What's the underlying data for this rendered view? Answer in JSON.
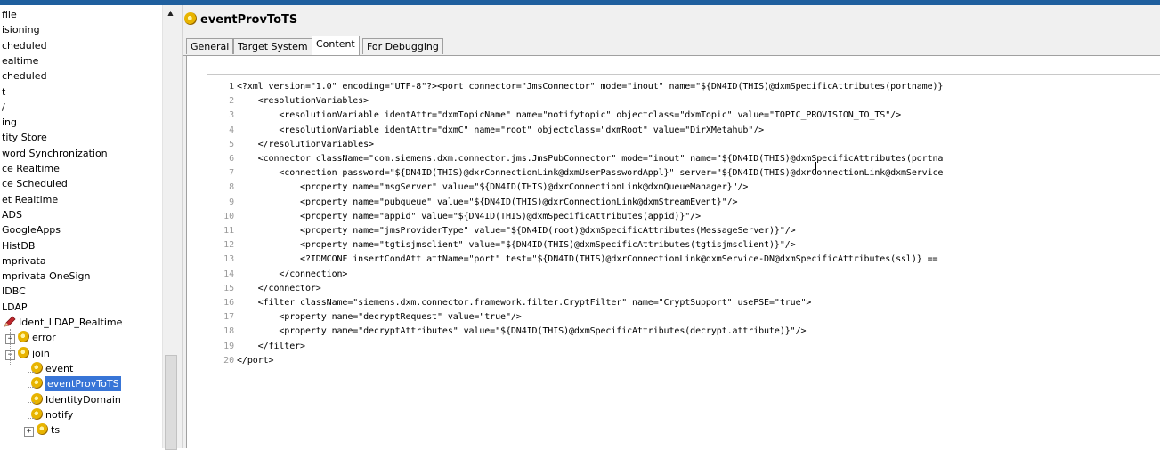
{
  "tree": {
    "items": [
      {
        "label": "file"
      },
      {
        "label": "isioning"
      },
      {
        "label": "cheduled"
      },
      {
        "label": "ealtime"
      },
      {
        "label": "cheduled"
      },
      {
        "label": "t"
      },
      {
        "label": "/"
      },
      {
        "label": "ing"
      },
      {
        "label": "tity Store"
      },
      {
        "label": "word Synchronization"
      },
      {
        "label": "ce Realtime"
      },
      {
        "label": "ce Scheduled"
      },
      {
        "label": "et Realtime"
      },
      {
        "label": "ADS"
      },
      {
        "label": "GoogleApps"
      },
      {
        "label": "HistDB"
      },
      {
        "label": "mprivata"
      },
      {
        "label": "mprivata OneSign"
      },
      {
        "label": "IDBC"
      },
      {
        "label": "LDAP"
      },
      {
        "label": "Ident_LDAP_Realtime",
        "icon": "pencil-icon"
      },
      {
        "label": "error",
        "icon": "gear-icon",
        "expander": "+"
      },
      {
        "label": "join",
        "icon": "gear-icon",
        "expander": "−"
      },
      {
        "label": "event",
        "icon": "gear-icon"
      },
      {
        "label": "eventProvToTS",
        "icon": "gear-icon",
        "selected": true
      },
      {
        "label": "IdentityDomain",
        "icon": "gear-icon"
      },
      {
        "label": "notify",
        "icon": "gear-icon"
      },
      {
        "label": "ts",
        "icon": "gear-icon",
        "expander": "+"
      }
    ]
  },
  "panel": {
    "title": "eventProvToTS",
    "title_icon": "gear-icon",
    "tabs": [
      {
        "label": "General"
      },
      {
        "label": "Target System"
      },
      {
        "label": "Content",
        "active": true
      },
      {
        "label": "For Debugging"
      }
    ]
  },
  "editor": {
    "lines": [
      {
        "n": "1",
        "text": "<?xml version=\"1.0\" encoding=\"UTF-8\"?><port connector=\"JmsConnector\" mode=\"inout\" name=\"${DN4ID(THIS)@dxmSpecificAttributes(portname)}"
      },
      {
        "n": "2",
        "text": "    <resolutionVariables>"
      },
      {
        "n": "3",
        "text": "        <resolutionVariable identAttr=\"dxmTopicName\" name=\"notifytopic\" objectclass=\"dxmTopic\" value=\"TOPIC_PROVISION_TO_TS\"/>"
      },
      {
        "n": "4",
        "text": "        <resolutionVariable identAttr=\"dxmC\" name=\"root\" objectclass=\"dxmRoot\" value=\"DirXMetahub\"/>"
      },
      {
        "n": "5",
        "text": "    </resolutionVariables>"
      },
      {
        "n": "6",
        "text": "    <connector className=\"com.siemens.dxm.connector.jms.JmsPubConnector\" mode=\"inout\" name=\"${DN4ID(THIS)@dxmSpecificAttributes(portna"
      },
      {
        "n": "7",
        "text": "        <connection password=\"${DN4ID(THIS)@dxrConnectionLink@dxmUserPasswordAppl}\" server=\"${DN4ID(THIS)@dxrConnectionLink@dxmService"
      },
      {
        "n": "8",
        "text": "            <property name=\"msgServer\" value=\"${DN4ID(THIS)@dxrConnectionLink@dxmQueueManager}\"/>"
      },
      {
        "n": "9",
        "text": "            <property name=\"pubqueue\" value=\"${DN4ID(THIS)@dxrConnectionLink@dxmStreamEvent}\"/>"
      },
      {
        "n": "10",
        "text": "            <property name=\"appid\" value=\"${DN4ID(THIS)@dxmSpecificAttributes(appid)}\"/>"
      },
      {
        "n": "11",
        "text": "            <property name=\"jmsProviderType\" value=\"${DN4ID(root)@dxmSpecificAttributes(MessageServer)}\"/>"
      },
      {
        "n": "12",
        "text": "            <property name=\"tgtisjmsclient\" value=\"${DN4ID(THIS)@dxmSpecificAttributes(tgtisjmsclient)}\"/>"
      },
      {
        "n": "13",
        "text": "            <?IDMCONF insertCondAtt attName=\"port\" test=\"${DN4ID(THIS)@dxrConnectionLink@dxmService-DN@dxmSpecificAttributes(ssl)} =="
      },
      {
        "n": "14",
        "text": "        </connection>"
      },
      {
        "n": "15",
        "text": "    </connector>"
      },
      {
        "n": "16",
        "text": "    <filter className=\"siemens.dxm.connector.framework.filter.CryptFilter\" name=\"CryptSupport\" usePSE=\"true\">"
      },
      {
        "n": "17",
        "text": "        <property name=\"decryptRequest\" value=\"true\"/>"
      },
      {
        "n": "18",
        "text": "        <property name=\"decryptAttributes\" value=\"${DN4ID(THIS)@dxmSpecificAttributes(decrypt.attribute)}\"/>"
      },
      {
        "n": "19",
        "text": "    </filter>"
      },
      {
        "n": "20",
        "text": "</port>"
      }
    ]
  }
}
